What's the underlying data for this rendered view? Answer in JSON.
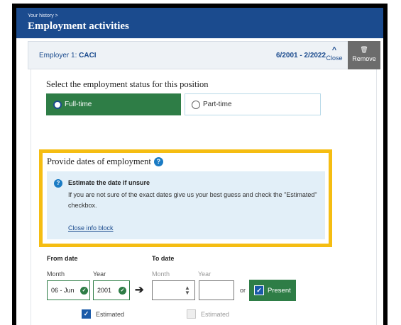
{
  "header": {
    "breadcrumb": "Your history >",
    "title": "Employment activities"
  },
  "employer": {
    "label_prefix": "Employer 1:",
    "name": "CACI",
    "date_range": "6/2001 - 2/2022",
    "close_label": "Close",
    "close_icon": "chevron-up-icon",
    "remove_label": "Remove",
    "remove_icon": "trash-icon"
  },
  "status": {
    "question": "Select the employment status for this position",
    "options": [
      {
        "label": "Full-time",
        "selected": true
      },
      {
        "label": "Part-time",
        "selected": false
      }
    ]
  },
  "dates": {
    "heading": "Provide dates of employment",
    "help_icon": "question-circle-icon",
    "info": {
      "title": "Estimate the date if unsure",
      "body": "If you are not sure of the exact dates give us your best guess and check the \"Estimated\" checkbox.",
      "close_link": "Close info block"
    },
    "from": {
      "label": "From date",
      "month_label": "Month",
      "year_label": "Year",
      "month_value": "06 - Jun",
      "year_value": "2001",
      "estimated_label": "Estimated",
      "estimated_checked": true
    },
    "to": {
      "label": "To date",
      "month_label": "Month",
      "year_label": "Year",
      "month_value": "",
      "year_value": "",
      "or_text": "or",
      "present_label": "Present",
      "present_checked": true,
      "estimated_label": "Estimated",
      "estimated_checked": false
    }
  },
  "colors": {
    "header_blue": "#1b4b8e",
    "success_green": "#2e7d46",
    "highlight_yellow": "#f5bd12",
    "info_bg": "#e2eff8",
    "remove_gray": "#6c6c6c"
  }
}
